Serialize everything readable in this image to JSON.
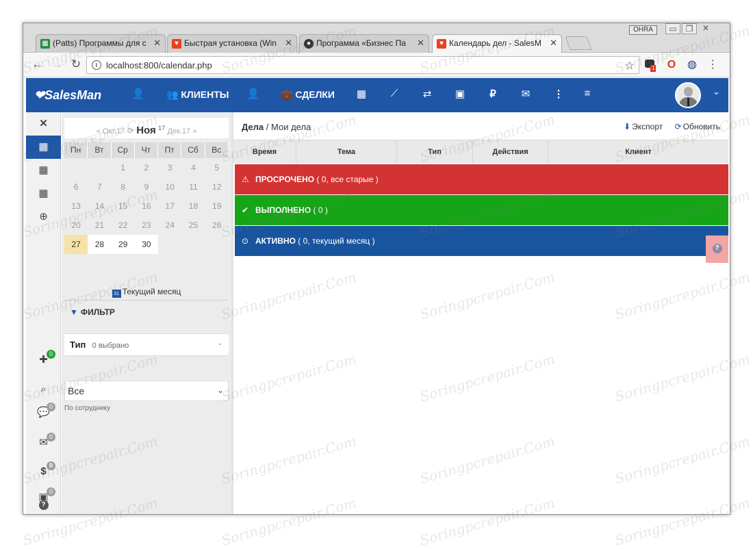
{
  "browser": {
    "window_controls": {
      "ohra": "OHRA",
      "minimize": "▭",
      "restore": "❐",
      "close": "✕"
    },
    "tabs": [
      {
        "title": "(Patts) Программы для с",
        "favicon_color": "#1e8e3e",
        "favicon": "sheet-icon"
      },
      {
        "title": "Быстрая установка (Win",
        "favicon_color": "#e8421e",
        "favicon": "heart-icon"
      },
      {
        "title": "Программа «Бизнес Па",
        "favicon_color": "#333333",
        "favicon": "globe-icon"
      },
      {
        "title": "Календарь дел - SalesM",
        "favicon_color": "#e8421e",
        "favicon": "heart-icon"
      }
    ],
    "url": "localhost:800/calendar.php",
    "ext_badge": "1"
  },
  "app": {
    "logo": "SalesMan",
    "nav": {
      "clients": "КЛИЕНТЫ",
      "deals": "СДЕЛКИ"
    }
  },
  "rail": {
    "badges": [
      "0",
      "0",
      "0",
      "0",
      "0",
      "0"
    ]
  },
  "calendar": {
    "prev": "« Окт.17",
    "current": "Ноя",
    "current_year": "17",
    "next": "Дек.17 »",
    "weekdays": [
      "Пн",
      "Вт",
      "Ср",
      "Чт",
      "Пт",
      "Сб",
      "Вс"
    ],
    "weeks": [
      [
        "",
        "",
        "1",
        "2",
        "3",
        "4",
        "5"
      ],
      [
        "6",
        "7",
        "8",
        "9",
        "10",
        "11",
        "12"
      ],
      [
        "13",
        "14",
        "15",
        "16",
        "17",
        "18",
        "19"
      ],
      [
        "20",
        "21",
        "22",
        "23",
        "24",
        "25",
        "26"
      ],
      [
        "27",
        "28",
        "29",
        "30",
        "",
        "",
        ""
      ]
    ],
    "today": "27",
    "current_month_button": "Текущий месяц"
  },
  "filter": {
    "title": "ФИЛЬТР",
    "type_label": "Тип",
    "type_count": "0 выбрано",
    "employee_value": "Все",
    "employee_caption": "По сотруднику"
  },
  "main": {
    "crumb_root": "Дела",
    "crumb_sep": "/",
    "crumb_page": "Мои дела",
    "export": "Экспорт",
    "refresh": "Обновить",
    "columns": [
      "Время",
      "Тема",
      "Тип",
      "Действия",
      "Клиент"
    ],
    "groups": [
      {
        "title": "ПРОСРОЧЕНО",
        "info": "( 0, все старые )",
        "color": "#d33333",
        "icon": "⚠"
      },
      {
        "title": "ВЫПОЛНЕНО",
        "info": "( 0 )",
        "color": "#16a516",
        "icon": "✔"
      },
      {
        "title": "АКТИВНО",
        "info": "( 0, текущий месяц )",
        "color": "#19559f",
        "icon": "⊙"
      }
    ],
    "help": "?"
  },
  "watermark": "Soringpcrepair.Com"
}
